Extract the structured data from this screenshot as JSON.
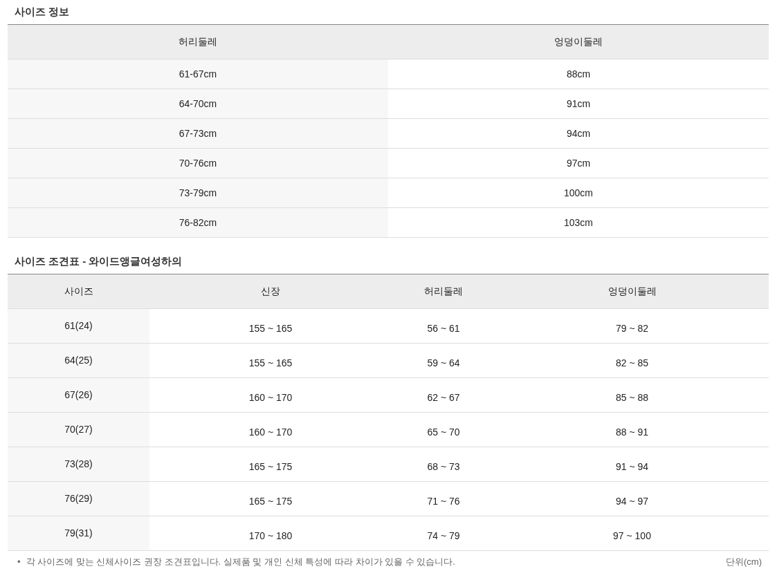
{
  "size_info": {
    "title": "사이즈 정보",
    "columns": [
      "허리둘레",
      "엉덩이둘레"
    ],
    "rows": [
      [
        "61-67cm",
        "88cm"
      ],
      [
        "64-70cm",
        "91cm"
      ],
      [
        "67-73cm",
        "94cm"
      ],
      [
        "70-76cm",
        "97cm"
      ],
      [
        "73-79cm",
        "100cm"
      ],
      [
        "76-82cm",
        "103cm"
      ]
    ]
  },
  "size_chart": {
    "title": "사이즈 조견표 - 와이드앵글여성하의",
    "columns": [
      "사이즈",
      "신장",
      "허리둘레",
      "엉덩이둘레"
    ],
    "rows": [
      [
        "61(24)",
        "155 ~ 165",
        "56 ~ 61",
        "79 ~ 82"
      ],
      [
        "64(25)",
        "155 ~ 165",
        "59 ~ 64",
        "82 ~ 85"
      ],
      [
        "67(26)",
        "160 ~ 170",
        "62 ~ 67",
        "85 ~ 88"
      ],
      [
        "70(27)",
        "160 ~ 170",
        "65 ~ 70",
        "88 ~ 91"
      ],
      [
        "73(28)",
        "165 ~ 175",
        "68 ~ 73",
        "91 ~ 94"
      ],
      [
        "76(29)",
        "165 ~ 175",
        "71 ~ 76",
        "94 ~ 97"
      ],
      [
        "79(31)",
        "170 ~ 180",
        "74 ~ 79",
        "97 ~ 100"
      ]
    ]
  },
  "footnote": {
    "bullet": "•",
    "text": "각 사이즈에 맞는 신체사이즈 권장 조견표입니다. 실제품 및 개인 신체 특성에 따라 차이가 있을 수 있습니다.",
    "unit": "단위(cm)"
  }
}
